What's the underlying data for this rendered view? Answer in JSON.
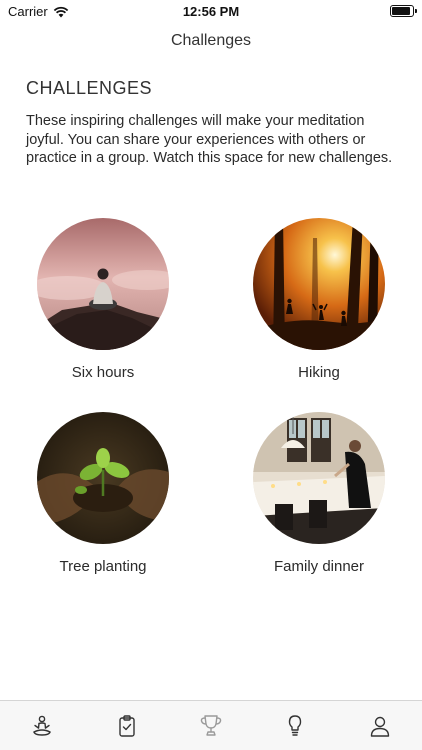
{
  "status": {
    "carrier": "Carrier",
    "time": "12:56 PM"
  },
  "nav": {
    "title": "Challenges"
  },
  "section": {
    "heading": "CHALLENGES",
    "description": "These inspiring challenges will make your meditation joyful. You can share your experiences with others or practice in a group. Watch this space for new challenges."
  },
  "challenges": [
    {
      "label": "Six hours",
      "image": "meditating-person-on-rock"
    },
    {
      "label": "Hiking",
      "image": "hikers-in-sunlit-forest"
    },
    {
      "label": "Tree planting",
      "image": "hands-holding-seedling"
    },
    {
      "label": "Family dinner",
      "image": "candlelit-dinner-table"
    }
  ],
  "tabs": [
    {
      "icon": "meditation-icon",
      "active": false
    },
    {
      "icon": "clipboard-check-icon",
      "active": false
    },
    {
      "icon": "trophy-icon",
      "active": true
    },
    {
      "icon": "lightbulb-icon",
      "active": false
    },
    {
      "icon": "profile-icon",
      "active": false
    }
  ],
  "colors": {
    "tab_icon": "#333333",
    "tab_icon_active": "#9a9a9a",
    "tab_bar_bg": "#f7f7f7"
  }
}
